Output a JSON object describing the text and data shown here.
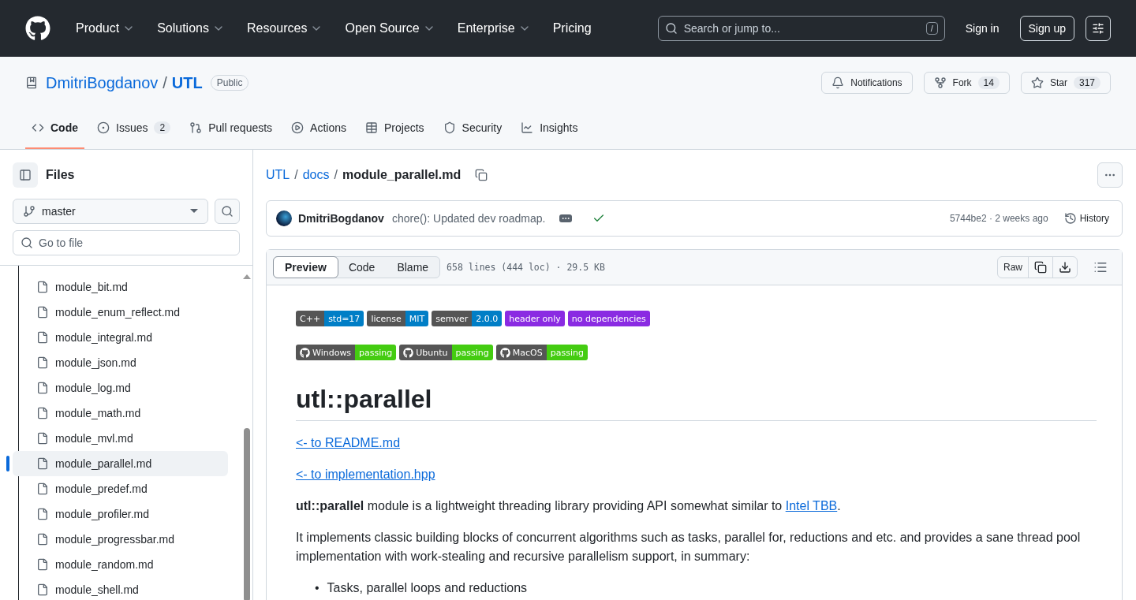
{
  "topnav": {
    "menus": [
      {
        "label": "Product",
        "dropdown": true
      },
      {
        "label": "Solutions",
        "dropdown": true
      },
      {
        "label": "Resources",
        "dropdown": true
      },
      {
        "label": "Open Source",
        "dropdown": true
      },
      {
        "label": "Enterprise",
        "dropdown": true
      },
      {
        "label": "Pricing",
        "dropdown": false
      }
    ],
    "search": {
      "placeholder": "Search or jump to...",
      "shortcut": "/"
    },
    "sign_in": "Sign in",
    "sign_up": "Sign up"
  },
  "repo": {
    "owner": "DmitriBogdanov",
    "separator": "/",
    "name": "UTL",
    "visibility": "Public",
    "actions": [
      {
        "kind": "bell",
        "label": "Notifications"
      },
      {
        "kind": "fork",
        "label": "Fork",
        "count": "14"
      },
      {
        "kind": "star",
        "label": "Star",
        "count": "317"
      }
    ],
    "tabs": [
      {
        "kind": "code",
        "label": "Code",
        "selected": true
      },
      {
        "kind": "issues",
        "label": "Issues",
        "count": "2",
        "selected": false
      },
      {
        "kind": "pulls",
        "label": "Pull requests",
        "selected": false
      },
      {
        "kind": "actions",
        "label": "Actions",
        "selected": false
      },
      {
        "kind": "projects",
        "label": "Projects",
        "selected": false
      },
      {
        "kind": "security",
        "label": "Security",
        "selected": false
      },
      {
        "kind": "insights",
        "label": "Insights",
        "selected": false
      }
    ]
  },
  "sidebar": {
    "title": "Files",
    "branch": "master",
    "filter_placeholder": "Go to file",
    "files": [
      {
        "name": "module_bit.md",
        "selected": false
      },
      {
        "name": "module_enum_reflect.md",
        "selected": false
      },
      {
        "name": "module_integral.md",
        "selected": false
      },
      {
        "name": "module_json.md",
        "selected": false
      },
      {
        "name": "module_log.md",
        "selected": false
      },
      {
        "name": "module_math.md",
        "selected": false
      },
      {
        "name": "module_mvl.md",
        "selected": false
      },
      {
        "name": "module_parallel.md",
        "selected": true
      },
      {
        "name": "module_predef.md",
        "selected": false
      },
      {
        "name": "module_profiler.md",
        "selected": false
      },
      {
        "name": "module_progressbar.md",
        "selected": false
      },
      {
        "name": "module_random.md",
        "selected": false
      },
      {
        "name": "module_shell.md",
        "selected": false
      }
    ]
  },
  "breadcrumb": [
    {
      "label": "UTL",
      "kind": "repo"
    },
    {
      "label": "/",
      "kind": "sep"
    },
    {
      "label": "docs",
      "kind": "link"
    },
    {
      "label": "/",
      "kind": "sep"
    },
    {
      "label": "module_parallel.md",
      "kind": "current"
    }
  ],
  "commit": {
    "author": "DmitriBogdanov",
    "message": "chore(): Updated dev roadmap.",
    "status_ok": true,
    "meta": "5744be2 · 2 weeks ago",
    "history": "History"
  },
  "file_view": {
    "modes": [
      {
        "label": "Preview",
        "selected": true
      },
      {
        "label": "Code",
        "selected": false
      },
      {
        "label": "Blame",
        "selected": false
      }
    ],
    "info": "658 lines (444 loc) · 29.5 KB",
    "raw": "Raw"
  },
  "readme": {
    "badge_rows": [
      [
        {
          "kind": "split",
          "label": "C++",
          "value": "std=17",
          "color": "#007ec6"
        },
        {
          "kind": "split",
          "label": "license",
          "value": "MIT",
          "color": "#007ec6"
        },
        {
          "kind": "split",
          "label": "semver",
          "value": "2.0.0",
          "color": "#007ec6"
        },
        {
          "kind": "single",
          "value": "header only",
          "color": "#8a2be2"
        },
        {
          "kind": "single",
          "value": "no dependencies",
          "color": "#8a2be2"
        }
      ],
      [
        {
          "kind": "github",
          "label": "Windows",
          "value": "passing",
          "color": "#44cc11"
        },
        {
          "kind": "github",
          "label": "Ubuntu",
          "value": "passing",
          "color": "#44cc11"
        },
        {
          "kind": "github",
          "label": "MacOS",
          "value": "passing",
          "color": "#44cc11"
        }
      ]
    ],
    "heading": "utl::parallel",
    "links": [
      "<- to README.md",
      "<- to implementation.hpp"
    ],
    "intro": {
      "text": "**utl::parallel** module is a lightweight threading library providing API somewhat similar to ",
      "link": "Intel TBB",
      "end": "."
    },
    "paragraph": "It implements classic building blocks of concurrent algorithms such as tasks, parallel for, reductions and etc. and provides a sane thread pool implementation with work-stealing and recursive parallelism support, in summary:",
    "bullets": [
      {
        "marker": "•",
        "text": "Tasks, parallel loops and reductions"
      }
    ]
  }
}
